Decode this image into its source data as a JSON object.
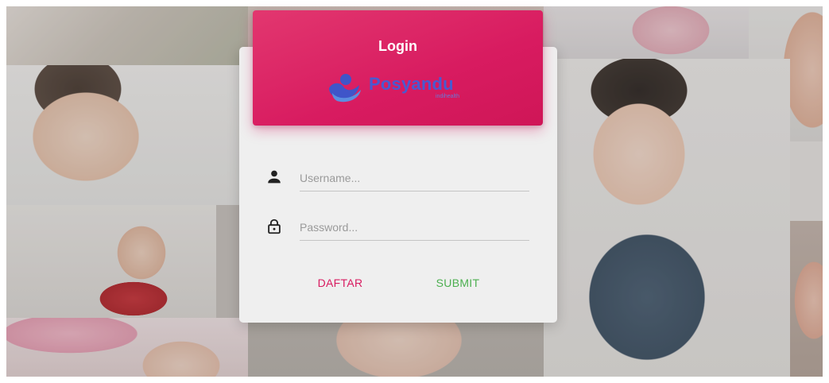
{
  "login_card": {
    "title": "Login",
    "logo_text": "Posyandu",
    "logo_subtext": "indihealth",
    "username_placeholder": "Username...",
    "password_placeholder": "Password...",
    "daftar_label": "DAFTAR",
    "submit_label": "SUBMIT"
  },
  "icons": {
    "username": "person-icon",
    "password": "lock-icon",
    "logo": "posyandu-logo-icon"
  },
  "colors": {
    "header_accent": "#d81b60",
    "daftar_text": "#d81b60",
    "submit_text": "#4caf50",
    "logo_text": "#4a5ad0",
    "card_background": "#efefef"
  }
}
